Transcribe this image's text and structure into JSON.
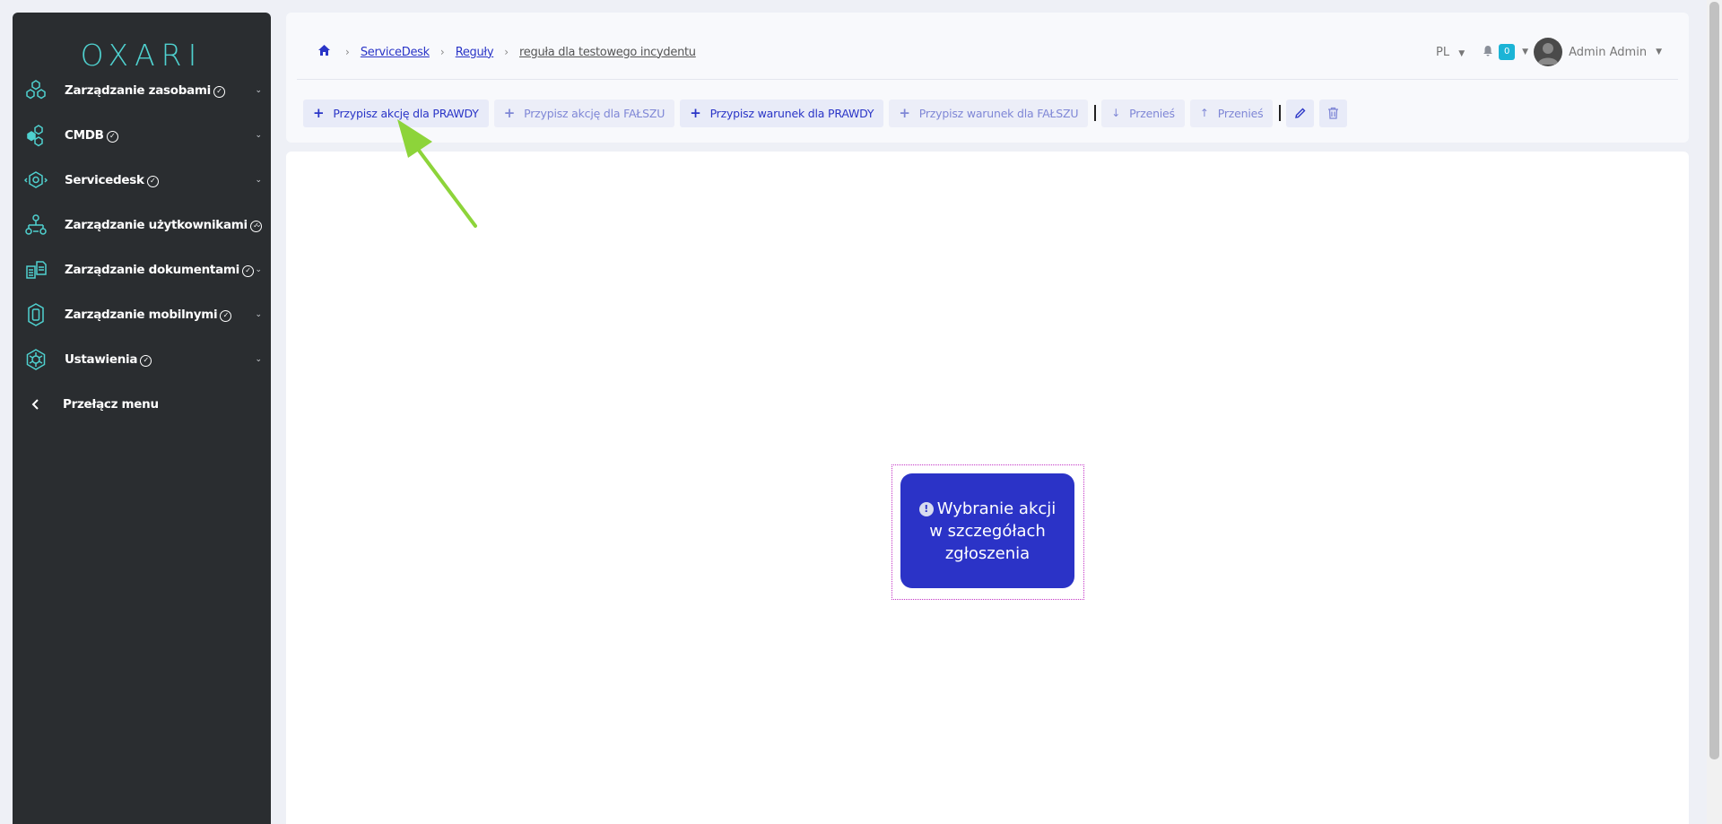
{
  "sidebar": {
    "logo": "OXARI",
    "items": [
      {
        "label": "Zarządzanie zasobami",
        "icon": "assets-icon"
      },
      {
        "label": "CMDB",
        "icon": "cmdb-icon"
      },
      {
        "label": "Servicedesk",
        "icon": "servicedesk-icon"
      },
      {
        "label": "Zarządzanie użytkownikami",
        "icon": "users-icon"
      },
      {
        "label": "Zarządzanie dokumentami",
        "icon": "documents-icon"
      },
      {
        "label": "Zarządzanie mobilnymi",
        "icon": "mobile-icon"
      },
      {
        "label": "Ustawienia",
        "icon": "settings-icon"
      }
    ],
    "toggle_label": "Przełącz menu"
  },
  "breadcrumb": {
    "items": [
      "ServiceDesk",
      "Reguły"
    ],
    "current": "reguła dla testowego incydentu"
  },
  "header": {
    "language": "PL",
    "notification_count": "0",
    "user_name": "Admin Admin"
  },
  "toolbar": {
    "assign_action_true": "Przypisz akcję dla PRAWDY",
    "assign_action_false": "Przypisz akcję dla FAŁSZU",
    "assign_condition_true": "Przypisz warunek dla PRAWDY",
    "assign_condition_false": "Przypisz warunek dla FAŁSZU",
    "move_down": "Przenieś",
    "move_up": "Przenieś"
  },
  "canvas": {
    "node_icon_glyph": "!",
    "node_label": "Wybranie akcji w szczegółach zgłoszenia"
  },
  "colors": {
    "sidebar_bg": "#2a2d30",
    "accent": "#2b33c7",
    "logo": "#4fd1cf",
    "badge": "#1bb4d6",
    "node_border": "#c436c6",
    "annotation_arrow": "#8dd43a"
  }
}
